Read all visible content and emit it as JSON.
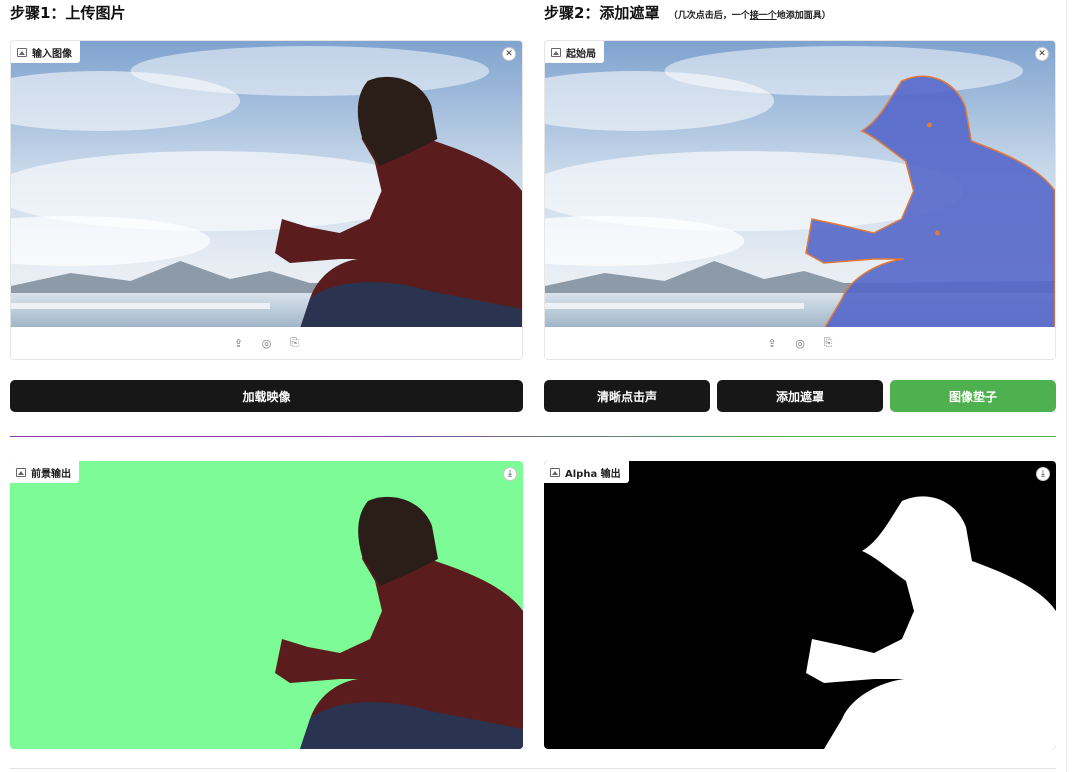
{
  "step1": {
    "title": "步骤1：上传图片"
  },
  "step2": {
    "title": "步骤2：添加遮罩",
    "hint_pre": "（几次点击后，一个",
    "hint_link": "接一个",
    "hint_post": "地添加面具）"
  },
  "panels": {
    "input": {
      "label": "输入图像",
      "close_glyph": "✕"
    },
    "start": {
      "label": "起始局",
      "close_glyph": "✕"
    },
    "foreground": {
      "label": "前景输出",
      "download_glyph": "⤓"
    },
    "alpha": {
      "label": "Alpha 输出",
      "download_glyph": "⤓"
    }
  },
  "toolbar_glyphs": {
    "upload": "⇪",
    "webcam": "◎",
    "paste": "⎘"
  },
  "buttons": {
    "load": "加载映像",
    "clear": "清晰点击声",
    "add_mask": "添加遮罩",
    "matte": "图像垫子"
  },
  "colors": {
    "button_dark": "#171717",
    "button_green": "#4fb04f",
    "mask_blue": "#5567c9",
    "mask_outline": "#e07a3a",
    "foreground_bg": "#7dfb96",
    "divider_purple": "#8a3bb0",
    "divider_green": "#4caf50"
  }
}
